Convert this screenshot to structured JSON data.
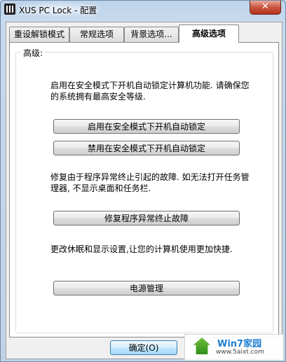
{
  "window": {
    "title": "XUS PC Lock - 配置",
    "close_glyph": "✕"
  },
  "tabs": [
    {
      "label": "重设解锁模式",
      "active": false
    },
    {
      "label": "常规选项",
      "active": false
    },
    {
      "label": "背景选项...",
      "active": false
    },
    {
      "label": "高级选项",
      "active": true
    }
  ],
  "advanced": {
    "group_label": "高级:",
    "safe_mode_desc": "启用在安全模式下开机自动锁定计算机功能. 请确保您的系统拥有最高安全等级.",
    "enable_safe_mode_label": "启用在安全模式下开机自动锁定",
    "disable_safe_mode_label": "禁用在安全模式下开机自动锁定",
    "repair_desc": "修复由于程序异常终止引起的故障. 如无法打开任务管理器, 不显示桌面和任务栏.",
    "repair_label": "修复程序异常终止故障",
    "power_desc": "更改休眠和显示设置,让您的计算机使用更加快捷.",
    "power_label": "电源管理"
  },
  "footer": {
    "ok_label": "确定(O)"
  },
  "watermark": {
    "title": "Win7家园",
    "url": "www.5aixt.com"
  }
}
